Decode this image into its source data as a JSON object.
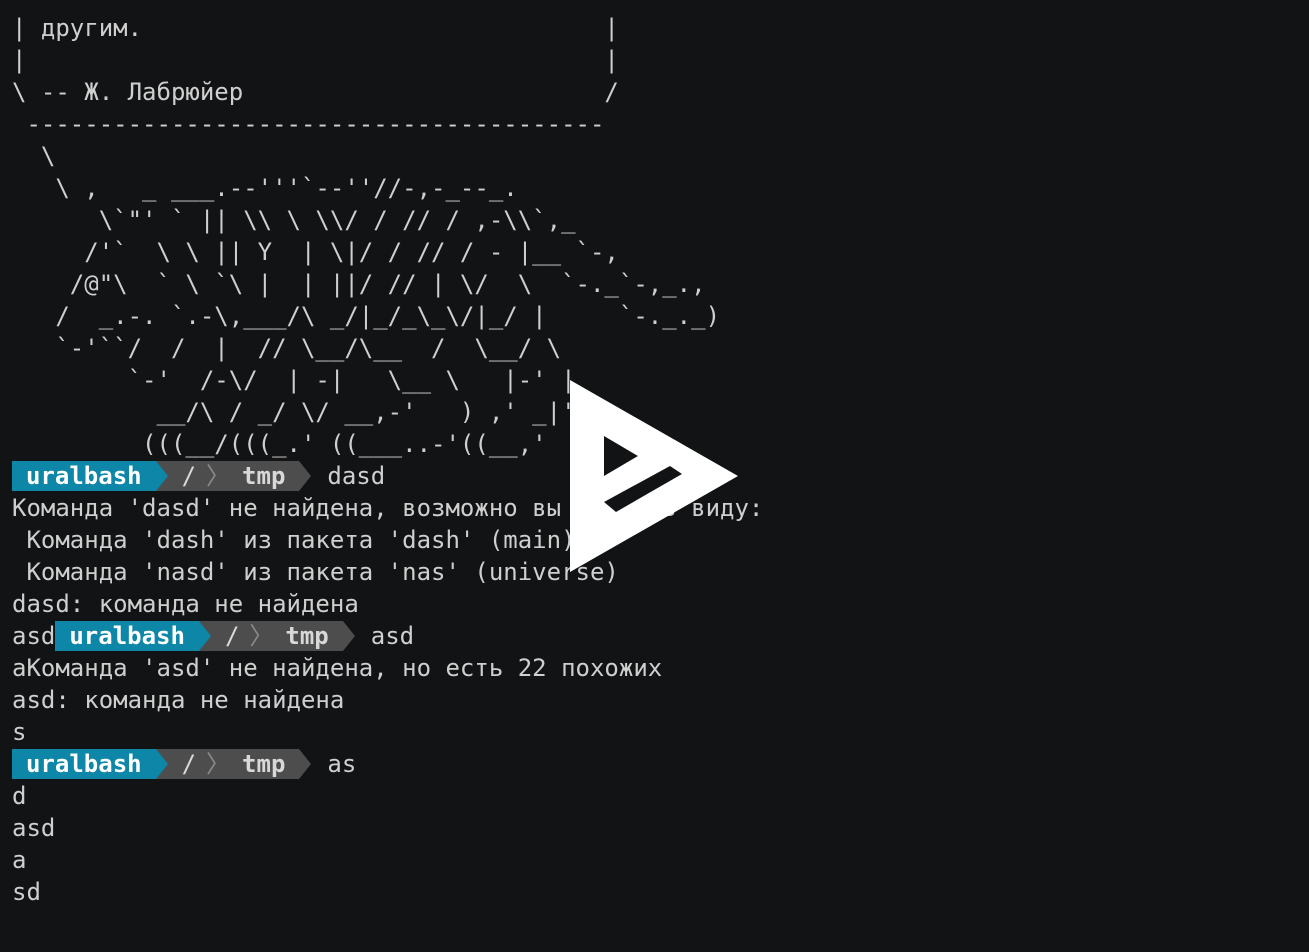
{
  "terminal": {
    "lines": [
      "| другим.                                |",
      "|                                        |",
      "\\ -- Ж. Лабрюйер                         /",
      " ----------------------------------------",
      "  \\",
      "   \\ ,   _ ___.--'''`--''//-,-_--_.",
      "      \\`\"' ` || \\\\ \\ \\\\/ / // / ,-\\\\`,_",
      "     /'`  \\ \\ || Y  | \\|/ / // / - |__ `-,",
      "    /@\"\\  ` \\ `\\ |  | ||/ // | \\/  \\  `-._`-,_.,",
      "   /  _.-. `.-\\,___/\\ _/|_/_\\_\\/|_/ |     `-._._)",
      "   `-'``/  /  |  // \\__/\\__  /  \\__/ \\",
      "        `-'  /-\\/  | -|   \\__ \\   |-' |",
      "          __/\\ / _/ \\/ __,-'   ) ,' _|'",
      "         (((__/(((_.' ((___..-'((__,'"
    ],
    "prompt1": {
      "user": "uralbash",
      "path_root": "/",
      "path_sep": ">",
      "dir": "tmp",
      "command": "dasd"
    },
    "output1": [
      "Команда 'dasd' не найдена, возможно вы имели в виду:",
      " Команда 'dash' из пакета 'dash' (main)",
      " Команда 'nasd' из пакета 'nas' (universe)",
      "dasd: команда не найдена"
    ],
    "prompt2_prefix": "asd",
    "prompt2": {
      "user": "uralbash",
      "path_root": "/",
      "path_sep": ">",
      "dir": "tmp",
      "command": "asd"
    },
    "output2": [
      "аКоманда 'asd' не найдена, но есть 22 похожих",
      "asd: команда не найдена",
      "s"
    ],
    "prompt3": {
      "user": "uralbash",
      "path_root": "/",
      "path_sep": ">",
      "dir": "tmp",
      "command": "as"
    },
    "output3": [
      "d",
      "asd",
      "a",
      "sd"
    ]
  },
  "overlay": {
    "icon": "asciinema-play-icon",
    "color": "#ffffff"
  },
  "colors": {
    "background": "#121314",
    "text": "#cfcfcf",
    "user_segment": "#0e86a8",
    "path_segment": "#4d4d4d"
  }
}
